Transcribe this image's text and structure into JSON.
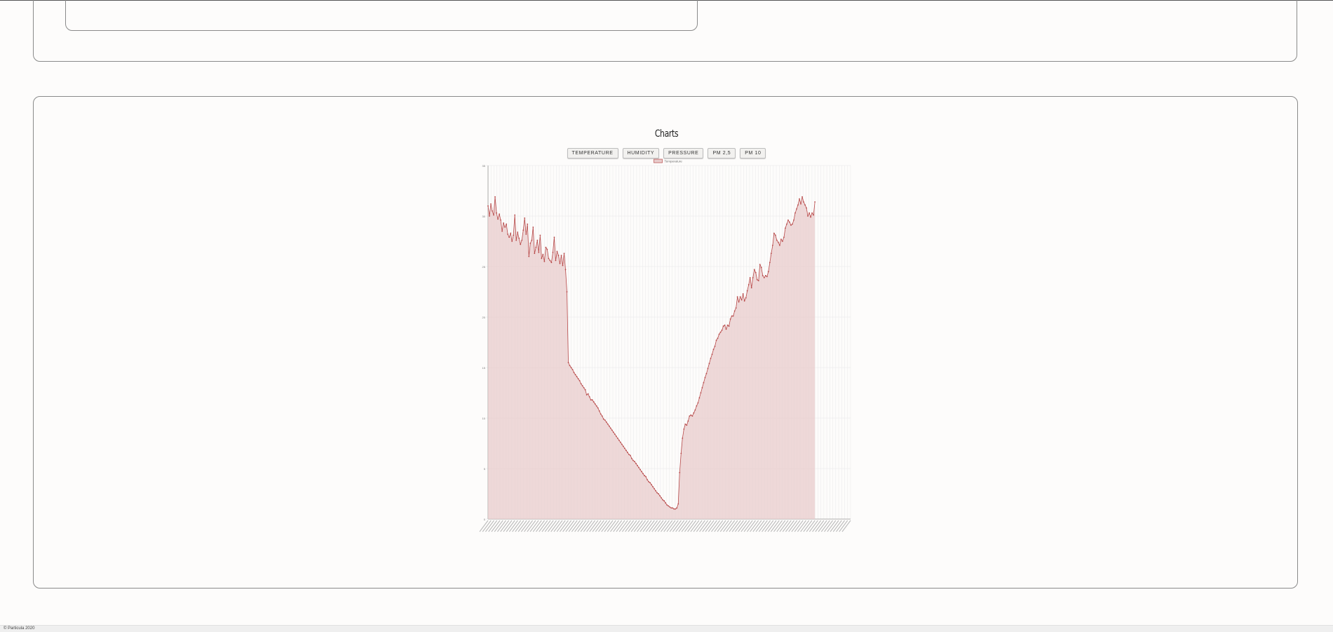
{
  "footer": {
    "text": "© Particula 2020"
  },
  "charts": {
    "title": "Charts",
    "buttons": [
      "TEMPERATURE",
      "HUMIDITY",
      "PRESSURE",
      "PM 2,5",
      "PM 10"
    ]
  },
  "colors": {
    "line": "#b84a4a",
    "fill": "#e8cccc",
    "grid": "#ececec"
  },
  "chart_data": {
    "type": "line",
    "legend": [
      "Temperature"
    ],
    "legend_position": "top",
    "grid": true,
    "ylim": [
      0,
      35
    ],
    "yticks": [
      "0",
      "5",
      "10",
      "15",
      "20",
      "25",
      "30",
      "35"
    ],
    "series": [
      {
        "name": "Temperature",
        "values": [
          31,
          30,
          31.2,
          30.5,
          30.1,
          31.9,
          30.3,
          29.7,
          30.2,
          29.6,
          28.5,
          29.3,
          28.9,
          29.2,
          28.2,
          27.9,
          28.3,
          27.5,
          28.1,
          30.1,
          27.6,
          28.4,
          27.8,
          27.2,
          27.6,
          28.6,
          29.8,
          28.2,
          29.2,
          26,
          27.3,
          27.6,
          28.9,
          26.3,
          26.9,
          27.6,
          26.4,
          28.1,
          25.8,
          26.2,
          25.5,
          26.9,
          26.7,
          25.8,
          25.6,
          25.4,
          26.4,
          27.9,
          25.6,
          26.5,
          26.1,
          25.3,
          26.1,
          25.1,
          26.3,
          24.7,
          22.5,
          15.5,
          15.2,
          15,
          14.8,
          14.5,
          14.3,
          14.1,
          13.9,
          13.7,
          13.4,
          13.2,
          13,
          12.8,
          12.3,
          12.4,
          12.1,
          11.8,
          11.8,
          11.6,
          11.4,
          11.2,
          11,
          10.7,
          10.4,
          10.2,
          9.9,
          9.8,
          9.6,
          9.4,
          9.2,
          9,
          8.8,
          8.6,
          8.4,
          8.2,
          8,
          7.8,
          7.6,
          7.4,
          7.2,
          7,
          6.8,
          6.6,
          6.4,
          6.3,
          6,
          5.8,
          5.7,
          5.5,
          5.3,
          5.1,
          4.9,
          4.7,
          4.5,
          4.3,
          4.2,
          3.9,
          3.7,
          3.6,
          3.4,
          3.2,
          3,
          2.8,
          2.6,
          2.5,
          2.3,
          2.1,
          1.9,
          1.8,
          1.6,
          1.4,
          1.3,
          1.2,
          1.1,
          1.1,
          1,
          1,
          1.1,
          1.5,
          4.6,
          6.5,
          8,
          8.9,
          9.4,
          9.3,
          9.7,
          10.2,
          10.3,
          10.2,
          10.5,
          10.8,
          11.2,
          11.5,
          12,
          12.5,
          13,
          13.5,
          14,
          14.4,
          14.9,
          15.4,
          15.9,
          16.3,
          16.8,
          17.1,
          17.7,
          17.9,
          18.3,
          18.5,
          18.7,
          19.1,
          19.2,
          18.8,
          19.2,
          19.1,
          19.8,
          20.1,
          20.1,
          20.6,
          20.9,
          22,
          21.5,
          22,
          21.7,
          22.3,
          21.6,
          21.9,
          22.6,
          23.2,
          23.9,
          22.9,
          23.9,
          24.7,
          24.4,
          23.7,
          23.6,
          25.2,
          24.9,
          24.1,
          23.9,
          24.1,
          24,
          24.5,
          25.4,
          26.3,
          27.1,
          28.3,
          28.1,
          27.6,
          27.4,
          27.1,
          27.7,
          27.5,
          27.9,
          28.8,
          29.2,
          29.6,
          29.4,
          29.1,
          29.2,
          29.6,
          30.3,
          30.7,
          31.1,
          31.7,
          31.2,
          31.9,
          31.4,
          31.1,
          30.8,
          30,
          30.3,
          29.9,
          30.3,
          30.1,
          31.4
        ]
      }
    ],
    "x_slots": 122
  }
}
